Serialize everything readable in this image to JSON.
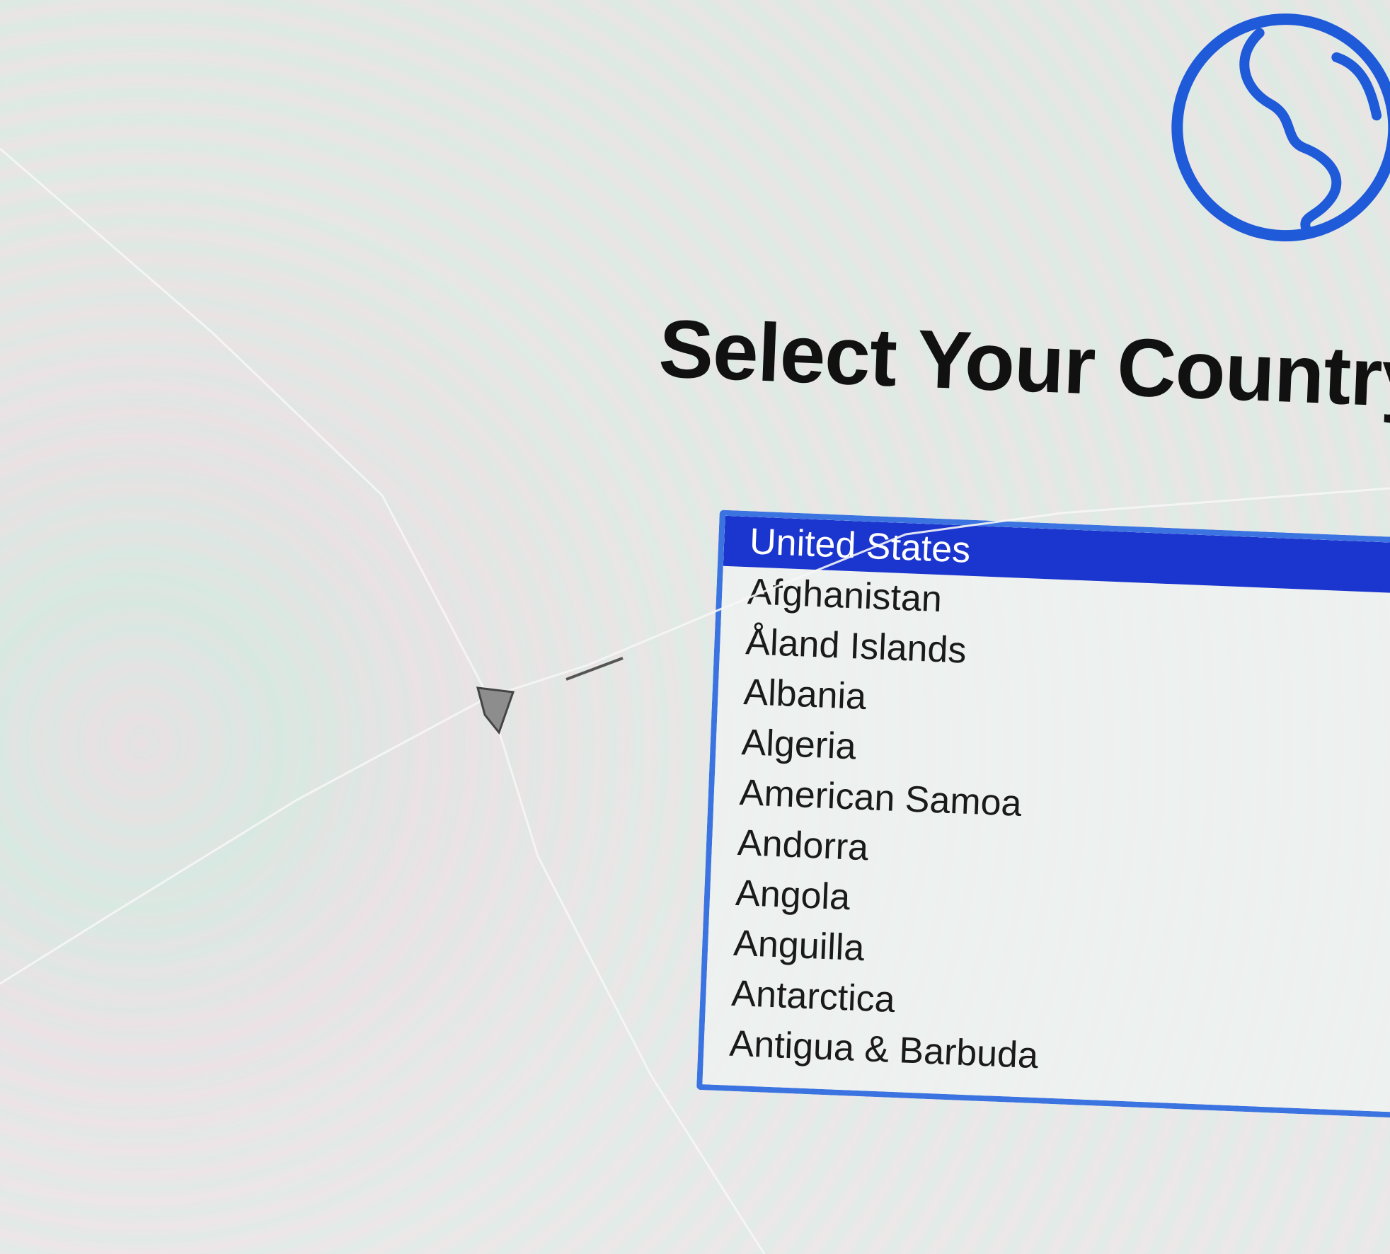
{
  "title": "Select Your Country",
  "icon": "globe-icon",
  "accent_color": "#1b35cf",
  "country_list": {
    "selected": "United States",
    "items": [
      "United States",
      "Afghanistan",
      "Åland Islands",
      "Albania",
      "Algeria",
      "American Samoa",
      "Andorra",
      "Angola",
      "Anguilla",
      "Antarctica",
      "Antigua & Barbuda"
    ]
  }
}
